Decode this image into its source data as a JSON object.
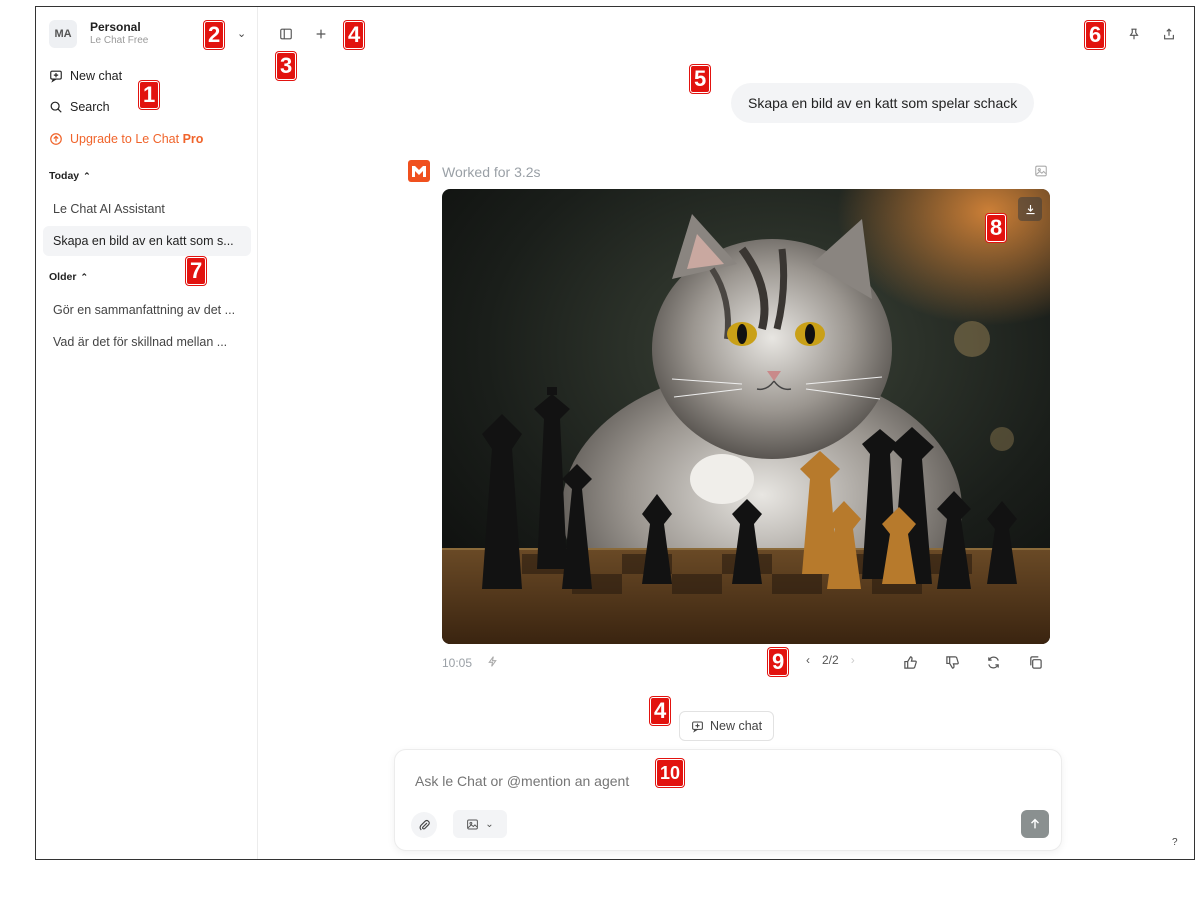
{
  "workspace": {
    "avatar": "MA",
    "name": "Personal",
    "plan": "Le Chat Free"
  },
  "nav": {
    "new_chat": "New chat",
    "search": "Search",
    "upgrade_prefix": "Upgrade to Le Chat ",
    "upgrade_bold": "Pro"
  },
  "sections": {
    "today": "Today",
    "older": "Older"
  },
  "history": {
    "today": [
      "Le Chat AI Assistant",
      "Skapa en bild av en katt som s..."
    ],
    "older": [
      "Gör en sammanfattning av det ...",
      "Vad är det för skillnad mellan ..."
    ]
  },
  "conversation": {
    "user_message": "Skapa en bild av en katt som spelar schack",
    "assistant_status": "Worked for 3.2s",
    "time": "10:05",
    "pager": "2/2"
  },
  "new_chat_chip": "New chat",
  "composer": {
    "placeholder": "Ask le Chat or @mention an agent"
  },
  "help": "?",
  "markers": [
    "1",
    "2",
    "3",
    "4",
    "5",
    "6",
    "7",
    "8",
    "9",
    "4",
    "10"
  ],
  "colors": {
    "accent": "#f0642b",
    "marker": "#e2130f",
    "send": "#8a9090"
  },
  "icons": [
    "new-chat-icon",
    "search-icon",
    "upgrade-icon",
    "sidebar-toggle-icon",
    "plus-icon",
    "pin-icon",
    "share-icon",
    "image-icon",
    "download-icon",
    "bolt-icon",
    "thumbs-up-icon",
    "thumbs-down-icon",
    "regenerate-icon",
    "copy-icon",
    "paperclip-icon",
    "send-arrow-icon"
  ]
}
